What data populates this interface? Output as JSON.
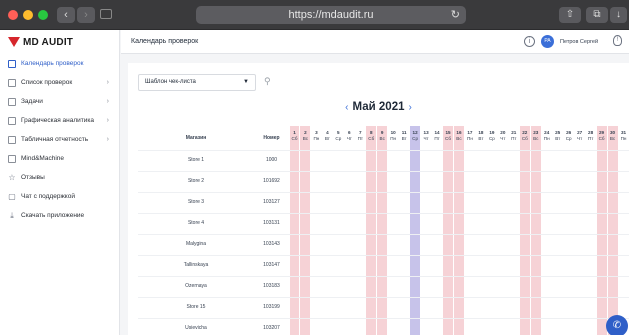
{
  "browser": {
    "url": "https://mdaudit.ru"
  },
  "logo": {
    "text": "MD AUDIT"
  },
  "sidebar": {
    "items": [
      {
        "label": "Календарь проверок",
        "icon": "calendar-icon",
        "active": true,
        "chevron": false
      },
      {
        "label": "Список проверок",
        "icon": "list-icon",
        "active": false,
        "chevron": true
      },
      {
        "label": "Задачи",
        "icon": "tasks-icon",
        "active": false,
        "chevron": true
      },
      {
        "label": "Графическая аналитика",
        "icon": "chart-icon",
        "active": false,
        "chevron": true
      },
      {
        "label": "Табличная отчетность",
        "icon": "table-icon",
        "active": false,
        "chevron": true
      },
      {
        "label": "Mind&Machine",
        "icon": "grid-icon",
        "active": false,
        "chevron": false
      },
      {
        "label": "Отзывы",
        "icon": "star-icon",
        "active": false,
        "chevron": false
      },
      {
        "label": "Чат с поддержкой",
        "icon": "chat-icon",
        "active": false,
        "chevron": false
      },
      {
        "label": "Скачать приложение",
        "icon": "download-icon",
        "active": false,
        "chevron": false
      }
    ]
  },
  "header": {
    "title": "Календарь проверок",
    "user_initials": "PA",
    "user_name": "Петров Сергей"
  },
  "filters": {
    "template_select": "Шаблон чек-листа"
  },
  "calendar": {
    "month_title": "Май 2021",
    "prev_arrow": "‹",
    "next_arrow": "›",
    "col_store": "Магазин",
    "col_number": "Номер",
    "today": 12,
    "days": [
      {
        "d": "1",
        "w": "Сб",
        "we": true
      },
      {
        "d": "2",
        "w": "Вс",
        "we": true
      },
      {
        "d": "3",
        "w": "Пн",
        "we": false
      },
      {
        "d": "4",
        "w": "Вт",
        "we": false
      },
      {
        "d": "5",
        "w": "Ср",
        "we": false
      },
      {
        "d": "6",
        "w": "Чт",
        "we": false
      },
      {
        "d": "7",
        "w": "Пт",
        "we": false
      },
      {
        "d": "8",
        "w": "Сб",
        "we": true
      },
      {
        "d": "9",
        "w": "Вс",
        "we": true
      },
      {
        "d": "10",
        "w": "Пн",
        "we": false
      },
      {
        "d": "11",
        "w": "Вт",
        "we": false
      },
      {
        "d": "12",
        "w": "Ср",
        "we": false
      },
      {
        "d": "13",
        "w": "Чт",
        "we": false
      },
      {
        "d": "14",
        "w": "Пт",
        "we": false
      },
      {
        "d": "15",
        "w": "Сб",
        "we": true
      },
      {
        "d": "16",
        "w": "Вс",
        "we": true
      },
      {
        "d": "17",
        "w": "Пн",
        "we": false
      },
      {
        "d": "18",
        "w": "Вт",
        "we": false
      },
      {
        "d": "19",
        "w": "Ср",
        "we": false
      },
      {
        "d": "20",
        "w": "Чт",
        "we": false
      },
      {
        "d": "21",
        "w": "Пт",
        "we": false
      },
      {
        "d": "22",
        "w": "Сб",
        "we": true
      },
      {
        "d": "23",
        "w": "Вс",
        "we": true
      },
      {
        "d": "24",
        "w": "Пн",
        "we": false
      },
      {
        "d": "25",
        "w": "Вт",
        "we": false
      },
      {
        "d": "26",
        "w": "Ср",
        "we": false
      },
      {
        "d": "27",
        "w": "Чт",
        "we": false
      },
      {
        "d": "28",
        "w": "Пт",
        "we": false
      },
      {
        "d": "29",
        "w": "Сб",
        "we": true
      },
      {
        "d": "30",
        "w": "Вс",
        "we": true
      },
      {
        "d": "31",
        "w": "Пн",
        "we": false
      }
    ],
    "rows": [
      {
        "store": "Store 1",
        "number": "1000"
      },
      {
        "store": "Store 2",
        "number": "101692"
      },
      {
        "store": "Store 3",
        "number": "103127"
      },
      {
        "store": "Store 4",
        "number": "103131"
      },
      {
        "store": "Malygina",
        "number": "103143"
      },
      {
        "store": "Tallinskaya",
        "number": "103147"
      },
      {
        "store": "Ozernaya",
        "number": "103183"
      },
      {
        "store": "Store 15",
        "number": "103199"
      },
      {
        "store": "Usievicha",
        "number": "103207"
      }
    ]
  },
  "colors": {
    "accent": "#2f5fc8",
    "weekend": "#f6d2d6",
    "today": "#c7c3ea",
    "brand": "#d6262c"
  }
}
